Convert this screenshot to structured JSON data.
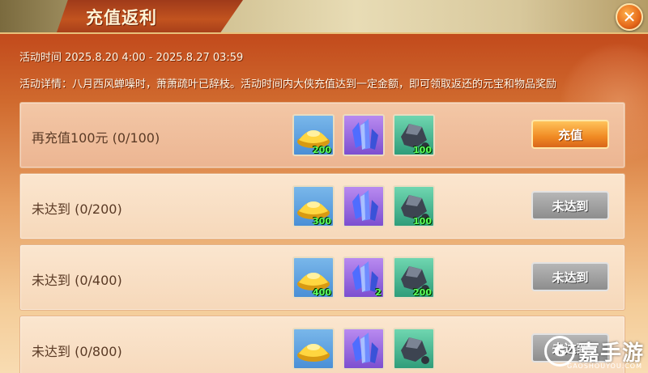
{
  "window": {
    "title": "充值返利",
    "close_label": "✕"
  },
  "activity": {
    "time": "活动时间  2025.8.20 4:00 - 2025.8.27 03:59",
    "details": "活动详情：八月西风蝉噪时，萧萧疏叶已辞枝。活动时间内大侠充值达到一定金额，即可领取返还的元宝和物品奖励"
  },
  "rows": [
    {
      "label": "再充值100元 (0/100)",
      "items": [
        {
          "icon": "gold-ingot-icon",
          "qty": "200"
        },
        {
          "icon": "blue-crystal-icon",
          "qty": ""
        },
        {
          "icon": "ore-stone-icon",
          "qty": "100"
        }
      ],
      "button": "充值",
      "state": "active"
    },
    {
      "label": "未达到 (0/200)",
      "items": [
        {
          "icon": "gold-ingot-icon",
          "qty": "300"
        },
        {
          "icon": "blue-crystal-icon",
          "qty": ""
        },
        {
          "icon": "ore-stone-icon",
          "qty": "100"
        }
      ],
      "button": "未达到",
      "state": "disabled"
    },
    {
      "label": "未达到 (0/400)",
      "items": [
        {
          "icon": "gold-ingot-icon",
          "qty": "400"
        },
        {
          "icon": "blue-crystal-icon",
          "qty": "2"
        },
        {
          "icon": "ore-stone-icon",
          "qty": "200"
        }
      ],
      "button": "未达到",
      "state": "disabled"
    },
    {
      "label": "未达到 (0/800)",
      "items": [
        {
          "icon": "gold-ingot-icon",
          "qty": ""
        },
        {
          "icon": "blue-crystal-icon",
          "qty": ""
        },
        {
          "icon": "ore-stone-icon",
          "qty": ""
        }
      ],
      "button": "未达到",
      "state": "disabled"
    }
  ],
  "watermark": {
    "logo_letter": "G",
    "text": "嘉手游",
    "sub": "GAOSHOUYOU.COM"
  },
  "colors": {
    "accent_orange": "#f08a23",
    "disabled_gray": "#8d8d8d",
    "qty_green": "#5cff5c"
  }
}
